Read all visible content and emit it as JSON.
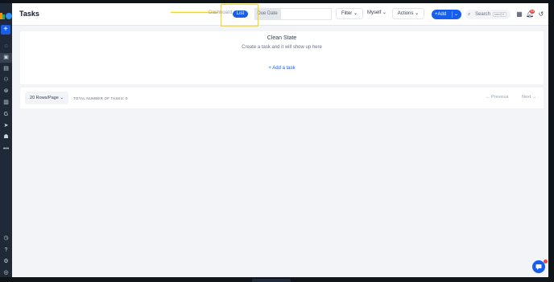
{
  "header": {
    "title": "Tasks",
    "tabs": [
      "Dashboard",
      "List",
      "Due Date"
    ],
    "filter_label": "Filter",
    "myself_label": "Myself",
    "actions_label": "Actions",
    "add_label": "Add",
    "search_placeholder": "Search",
    "search_kbd": [
      "cmd",
      "K"
    ],
    "notification_count": "44"
  },
  "empty_state": {
    "title": "Clean State",
    "subtitle": "Create a task and it will show up here",
    "add_task": "+ Add a task"
  },
  "pagination": {
    "rows_per_page": "20 Rows/Page",
    "total_label": "TOTAL NUMBER OF TASKS: 0",
    "previous": "Previous",
    "next": "Next"
  },
  "colors": {
    "accent": "#155eef",
    "highlight": "#ffd800",
    "sidebar": "#1f2937"
  }
}
